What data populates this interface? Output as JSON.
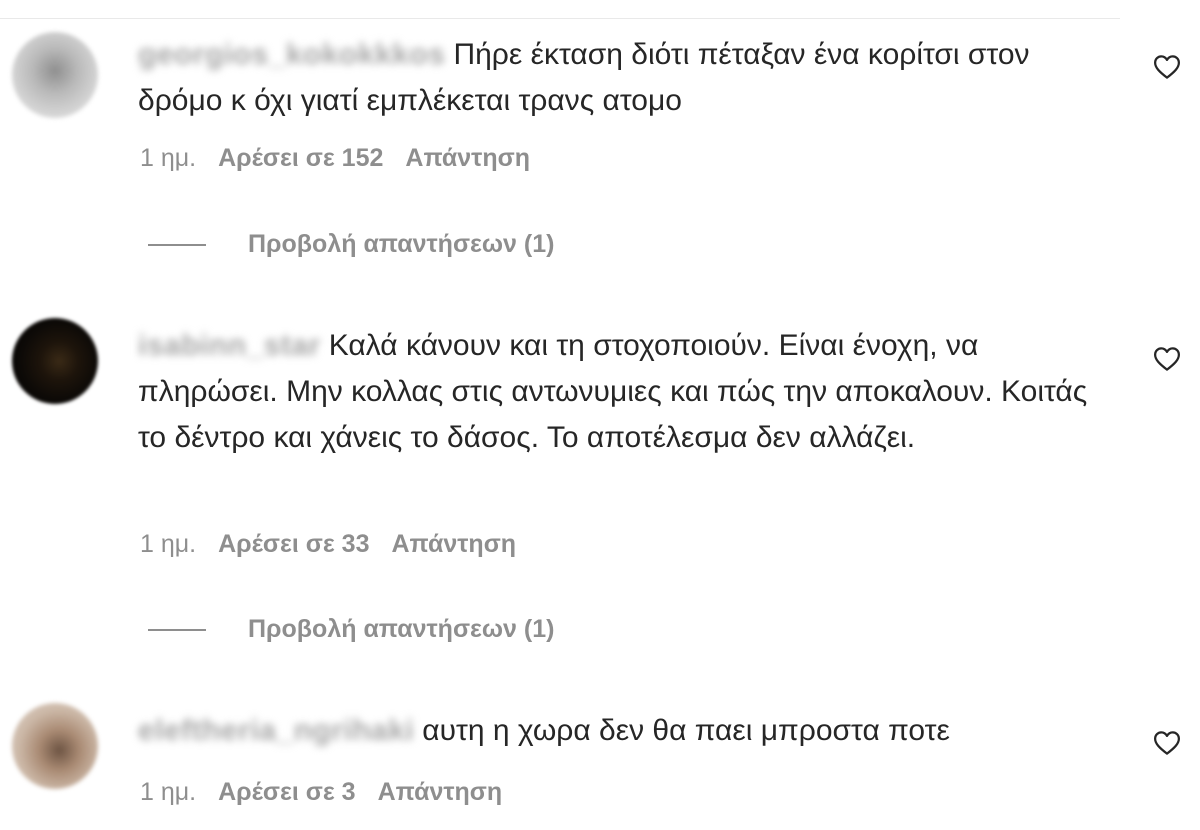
{
  "comments": [
    {
      "username": "georgios_kokokkkos",
      "text": "Πήρε έκταση διότι πέταξαν ένα κορίτσι στον δρόμο κ όχι γιατί εμπλέκεται τρανς ατομο",
      "time": "1 ημ.",
      "likes": "Αρέσει σε 152",
      "reply": "Απάντηση",
      "view_replies": "Προβολή απαντήσεων (1)"
    },
    {
      "username": "isabinn_star",
      "text": "Καλά κάνουν και τη στοχοποιούν. Είναι ένοχη, να πληρώσει. Μην κολλας στις αντωνυμιες και πώς την αποκαλουν. Κοιτάς το δέντρο και χάνεις το δάσος. Το αποτέλεσμα δεν αλλάζει.",
      "time": "1 ημ.",
      "likes": "Αρέσει σε 33",
      "reply": "Απάντηση",
      "view_replies": "Προβολή απαντήσεων (1)"
    },
    {
      "username": "eleftheria_ngrihaki",
      "text": "αυτη η χωρα δεν θα παει μπροστα ποτε",
      "time": "1 ημ.",
      "likes": "Αρέσει σε 3",
      "reply": "Απάντηση"
    }
  ],
  "icons": {
    "like": "heart-outline-icon",
    "avatar": "profile-picture"
  },
  "colors": {
    "text": "#262626",
    "secondary": "#8e8e8e",
    "background": "#ffffff"
  }
}
